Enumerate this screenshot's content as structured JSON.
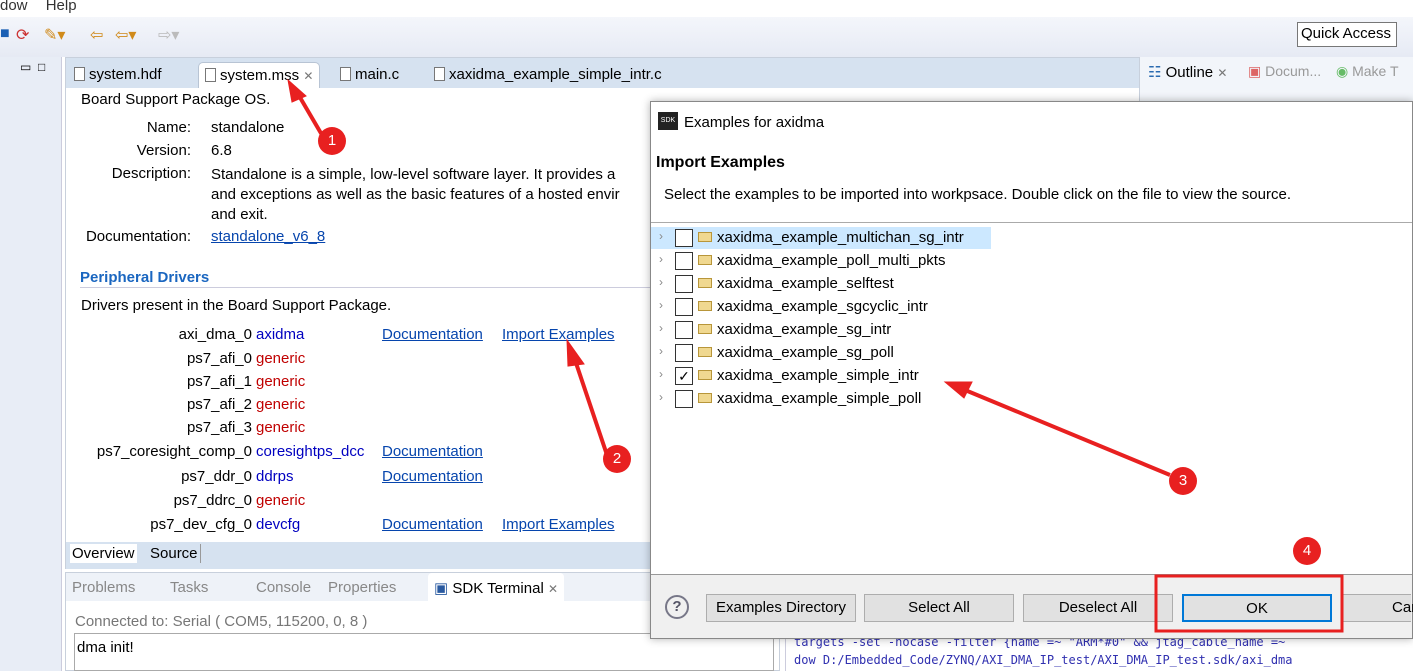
{
  "menubar": {
    "items": [
      "dow",
      "Help"
    ]
  },
  "toolbar": {
    "quick_access": "Quick Access"
  },
  "editor": {
    "tabs": [
      "system.hdf",
      "system.mss",
      "main.c",
      "xaxidma_example_simple_intr.c"
    ],
    "heading": "Board Support Package OS.",
    "name_label": "Name:",
    "name_value": "standalone",
    "version_label": "Version:",
    "version_value": "6.8",
    "description_label": "Description:",
    "description_lines": [
      "Standalone is a simple, low-level software layer. It provides a",
      "and exceptions as well as the basic features of a hosted envir",
      "and exit."
    ],
    "documentation_label": "Documentation:",
    "documentation_link": "standalone_v6_8",
    "peripheral_heading": "Peripheral Drivers",
    "peripheral_desc": "Drivers present in the Board Support Package.",
    "drivers": [
      {
        "name": "axi_dma_0",
        "driver": "axidma",
        "type": "drv",
        "doc": "Documentation",
        "import": "Import Examples"
      },
      {
        "name": "ps7_afi_0",
        "driver": "generic",
        "type": "gen"
      },
      {
        "name": "ps7_afi_1",
        "driver": "generic",
        "type": "gen"
      },
      {
        "name": "ps7_afi_2",
        "driver": "generic",
        "type": "gen"
      },
      {
        "name": "ps7_afi_3",
        "driver": "generic",
        "type": "gen"
      },
      {
        "name": "ps7_coresight_comp_0",
        "driver": "coresightps_dcc",
        "type": "drv",
        "doc": "Documentation"
      },
      {
        "name": "ps7_ddr_0",
        "driver": "ddrps",
        "type": "drv",
        "doc": "Documentation"
      },
      {
        "name": "ps7_ddrc_0",
        "driver": "generic",
        "type": "gen"
      },
      {
        "name": "ps7_dev_cfg_0",
        "driver": "devcfg",
        "type": "drv",
        "doc": "Documentation",
        "import": "Import Examples"
      }
    ],
    "bottom_tabs": [
      "Overview",
      "Source"
    ]
  },
  "outline": {
    "tabs": [
      "Outline",
      "Docum...",
      "Make T"
    ]
  },
  "dialog": {
    "title": "Examples for axidma",
    "logo": "SDK",
    "heading": "Import Examples",
    "description": "Select the examples to be imported into workpsace. Double click on the file to view the source.",
    "examples": [
      {
        "name": "xaxidma_example_multichan_sg_intr",
        "checked": false
      },
      {
        "name": "xaxidma_example_poll_multi_pkts",
        "checked": false
      },
      {
        "name": "xaxidma_example_selftest",
        "checked": false
      },
      {
        "name": "xaxidma_example_sgcyclic_intr",
        "checked": false
      },
      {
        "name": "xaxidma_example_sg_intr",
        "checked": false
      },
      {
        "name": "xaxidma_example_sg_poll",
        "checked": false
      },
      {
        "name": "xaxidma_example_simple_intr",
        "checked": true
      },
      {
        "name": "xaxidma_example_simple_poll",
        "checked": false
      }
    ],
    "buttons": {
      "examples_dir": "Examples Directory",
      "select_all": "Select All",
      "deselect_all": "Deselect All",
      "ok": "OK",
      "cancel": "Car"
    }
  },
  "bottom": {
    "tabs": [
      "Problems",
      "Tasks",
      "Console",
      "Properties",
      "SDK Terminal"
    ],
    "connected": "Connected to: Serial (  COM5, 115200, 0, 8 )",
    "terminal_text": "dma init!"
  },
  "console_lines": [
    "targets -set -nocase -filter {name =~ \"ARM*#0\" && jtag_cable_name =~",
    "dow D:/Embedded_Code/ZYNQ/AXI_DMA_IP_test/AXI_DMA_IP_test.sdk/axi_dma"
  ],
  "annotations": [
    "1",
    "2",
    "3",
    "4"
  ],
  "colors": {
    "annotation": "#e82020",
    "link": "#0645ad",
    "selected_row": "#cce8ff"
  }
}
